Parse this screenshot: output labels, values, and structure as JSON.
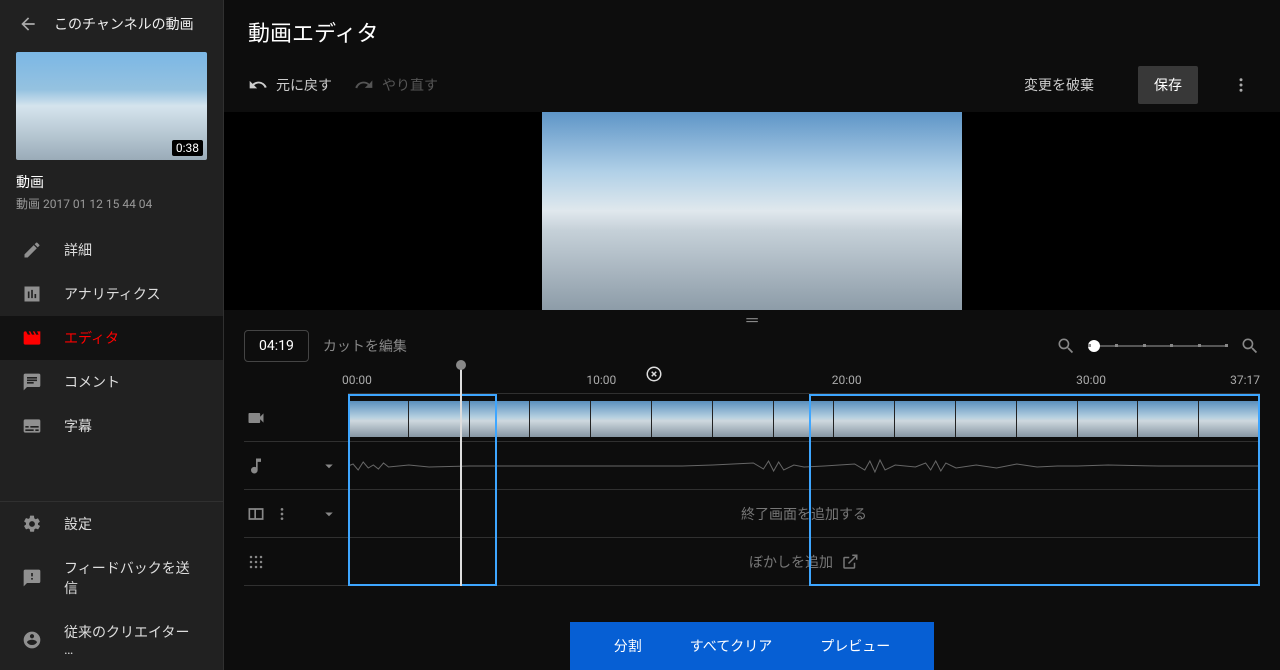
{
  "sidebar": {
    "back_label": "このチャンネルの動画",
    "thumbnail_duration": "0:38",
    "video_title": "動画",
    "video_date": "動画 2017 01 12 15 44 04",
    "nav": [
      {
        "icon": "pencil",
        "label": "詳細"
      },
      {
        "icon": "chart",
        "label": "アナリティクス"
      },
      {
        "icon": "editor",
        "label": "エディタ",
        "active": true
      },
      {
        "icon": "comment",
        "label": "コメント"
      },
      {
        "icon": "subtitle",
        "label": "字幕"
      }
    ],
    "footer": [
      {
        "icon": "gear",
        "label": "設定"
      },
      {
        "icon": "feedback",
        "label": "フィードバックを送信"
      },
      {
        "icon": "creator",
        "label": "従来のクリエイター …"
      }
    ]
  },
  "header": {
    "title": "動画エディタ",
    "undo": "元に戻す",
    "redo": "やり直す",
    "discard": "変更を破棄",
    "save": "保存"
  },
  "controls": {
    "current_time": "04:19",
    "edit_cut": "カットを編集"
  },
  "ruler": {
    "marks": [
      {
        "t": "00:00",
        "pos": 0
      },
      {
        "t": "10:00",
        "pos": 26.8
      },
      {
        "t": "20:00",
        "pos": 53.7
      },
      {
        "t": "30:00",
        "pos": 80.5
      },
      {
        "t": "37:17",
        "pos": 100
      }
    ],
    "close_pos": 32.6
  },
  "tracks": {
    "endscreen": "終了画面を追加する",
    "blur": "ぼかしを追加"
  },
  "selection": {
    "a": {
      "left": 0,
      "width": 16.3
    },
    "b": {
      "left": 50.5,
      "width": 49.5
    },
    "playhead_pos": 12.3
  },
  "actions": {
    "split": "分割",
    "clear_all": "すべてクリア",
    "preview": "プレビュー"
  }
}
